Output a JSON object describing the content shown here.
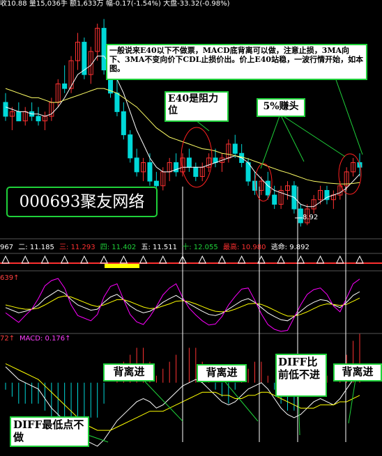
{
  "header": {
    "parts": [
      "收10.88",
      "量15,036手",
      "额1,633万",
      "幅-0.17(-1.54%)",
      "大盘-33.32(-0.98%)"
    ]
  },
  "stock_label": "000693聚友网络",
  "annotations": {
    "top_note": "一般说来E40以下不做票，MACD底背离可以做，注意止损，3MA向下、3MA不变向价下CDL止损价出。价上E40站稳，一波行情开始，如本图。",
    "resistance": "E40是阻力位",
    "profit": "5%赚头",
    "diverge_1": "背离进",
    "diverge_2": "背离进",
    "diff_low": "DIFF比前低不进",
    "diverge_3": "背离进",
    "diff_bottom": "DIFF最低点不做",
    "low_price": "8.92"
  },
  "ma_row": [
    {
      "label": "967",
      "color": "#ffffff"
    },
    {
      "label": "二: 11.185",
      "color": "#ffffff"
    },
    {
      "label": "三: 11.293",
      "color": "#ff3030"
    },
    {
      "label": "四: 11.402",
      "color": "#1fd23a"
    },
    {
      "label": "五: 11.511",
      "color": "#ffffff"
    },
    {
      "label": "十: 12.055",
      "color": "#1fd23a"
    },
    {
      "label": "最高: 10.980",
      "color": "#ff3030"
    },
    {
      "label": "逃命: 9.892",
      "color": "#ffffff"
    }
  ],
  "indicator_labels": {
    "kdj": "639↑",
    "macd_prefix": "72↑",
    "macd": "MACD: 0.176↑"
  },
  "colors": {
    "up": "#ff3232",
    "down": "#00d8d8",
    "ma_white": "#ffffff",
    "ma_yellow": "#ffff66",
    "note_border": "#1fd23a",
    "kdj_k": "#ffffff",
    "kdj_d": "#ffff00",
    "kdj_j": "#ff00ff"
  },
  "chart_data": {
    "type": "line",
    "price_candles_ohlc": [
      [
        11.6,
        11.8,
        11.2,
        11.3
      ],
      [
        11.3,
        11.5,
        11.0,
        11.4
      ],
      [
        11.4,
        11.6,
        11.2,
        11.2
      ],
      [
        11.2,
        11.5,
        11.1,
        11.4
      ],
      [
        11.4,
        11.6,
        11.2,
        11.3
      ],
      [
        11.3,
        11.5,
        11.1,
        11.2
      ],
      [
        11.2,
        11.4,
        11.0,
        11.3
      ],
      [
        11.3,
        11.7,
        11.2,
        11.6
      ],
      [
        11.6,
        12.1,
        11.5,
        12.0
      ],
      [
        12.0,
        12.4,
        11.8,
        11.9
      ],
      [
        11.9,
        12.6,
        11.8,
        12.5
      ],
      [
        12.5,
        13.1,
        12.3,
        12.9
      ],
      [
        12.9,
        13.0,
        12.1,
        12.2
      ],
      [
        12.2,
        12.8,
        12.0,
        12.7
      ],
      [
        12.7,
        13.3,
        12.5,
        13.2
      ],
      [
        13.2,
        13.4,
        12.2,
        12.3
      ],
      [
        12.3,
        12.6,
        11.7,
        11.8
      ],
      [
        11.8,
        12.1,
        11.3,
        11.4
      ],
      [
        11.4,
        11.6,
        10.8,
        10.9
      ],
      [
        10.9,
        11.0,
        10.3,
        10.4
      ],
      [
        10.4,
        10.6,
        10.0,
        10.1
      ],
      [
        10.1,
        10.4,
        9.9,
        10.3
      ],
      [
        10.3,
        10.5,
        9.8,
        9.9
      ],
      [
        9.9,
        10.1,
        9.6,
        9.8
      ],
      [
        9.8,
        10.2,
        9.7,
        10.1
      ],
      [
        10.1,
        10.4,
        9.9,
        10.3
      ],
      [
        10.3,
        10.5,
        10.0,
        10.1
      ],
      [
        10.1,
        10.5,
        10.0,
        10.4
      ],
      [
        10.4,
        10.6,
        10.1,
        10.2
      ],
      [
        10.2,
        10.3,
        9.9,
        10.0
      ],
      [
        10.0,
        10.3,
        9.9,
        10.2
      ],
      [
        10.2,
        10.5,
        10.1,
        10.4
      ],
      [
        10.4,
        10.6,
        10.2,
        10.3
      ],
      [
        10.3,
        10.5,
        10.1,
        10.4
      ],
      [
        10.4,
        10.8,
        10.3,
        10.7
      ],
      [
        10.7,
        10.9,
        10.4,
        10.5
      ],
      [
        10.5,
        10.7,
        10.2,
        10.3
      ],
      [
        10.3,
        10.4,
        9.8,
        9.9
      ],
      [
        9.9,
        10.1,
        9.6,
        9.7
      ],
      [
        9.7,
        10.0,
        9.6,
        9.9
      ],
      [
        9.9,
        10.1,
        9.5,
        9.6
      ],
      [
        9.6,
        9.8,
        9.3,
        9.4
      ],
      [
        9.4,
        9.8,
        9.3,
        9.7
      ],
      [
        9.7,
        9.9,
        9.5,
        9.8
      ],
      [
        9.8,
        9.9,
        9.2,
        9.3
      ],
      [
        9.3,
        9.4,
        8.92,
        9.0
      ],
      [
        9.0,
        9.4,
        8.95,
        9.3
      ],
      [
        9.3,
        9.6,
        9.2,
        9.5
      ],
      [
        9.5,
        9.8,
        9.4,
        9.7
      ],
      [
        9.7,
        9.8,
        9.4,
        9.5
      ],
      [
        9.5,
        9.7,
        9.3,
        9.6
      ],
      [
        9.6,
        9.9,
        9.5,
        9.8
      ],
      [
        9.8,
        10.2,
        9.7,
        10.1
      ],
      [
        10.1,
        10.4,
        10.0,
        10.3
      ],
      [
        10.3,
        10.5,
        10.0,
        10.2
      ]
    ],
    "price_ma_white": [
      11.5,
      11.45,
      11.4,
      11.4,
      11.35,
      11.35,
      11.3,
      11.35,
      11.5,
      11.7,
      11.95,
      12.2,
      12.3,
      12.4,
      12.6,
      12.6,
      12.4,
      12.1,
      11.8,
      11.4,
      11.0,
      10.7,
      10.4,
      10.2,
      10.1,
      10.1,
      10.15,
      10.2,
      10.2,
      10.2,
      10.2,
      10.25,
      10.3,
      10.35,
      10.4,
      10.45,
      10.4,
      10.3,
      10.1,
      9.95,
      9.8,
      9.7,
      9.65,
      9.6,
      9.55,
      9.4,
      9.35,
      9.35,
      9.45,
      9.55,
      9.6,
      9.65,
      9.75,
      9.9,
      10.05
    ],
    "price_ma_yellow": [
      11.9,
      11.85,
      11.8,
      11.75,
      11.7,
      11.7,
      11.65,
      11.6,
      11.6,
      11.65,
      11.7,
      11.75,
      11.8,
      11.85,
      11.9,
      11.9,
      11.85,
      11.8,
      11.7,
      11.6,
      11.5,
      11.35,
      11.2,
      11.05,
      10.95,
      10.85,
      10.8,
      10.75,
      10.7,
      10.65,
      10.6,
      10.58,
      10.55,
      10.5,
      10.48,
      10.45,
      10.42,
      10.38,
      10.33,
      10.28,
      10.22,
      10.17,
      10.12,
      10.08,
      10.03,
      9.98,
      9.93,
      9.9,
      9.88,
      9.86,
      9.85,
      9.84,
      9.84,
      9.85,
      9.87
    ],
    "kdj_k": [
      45,
      40,
      35,
      38,
      42,
      50,
      62,
      70,
      78,
      72,
      60,
      50,
      45,
      40,
      42,
      55,
      65,
      70,
      60,
      48,
      40,
      35,
      38,
      45,
      55,
      62,
      68,
      60,
      52,
      45,
      38,
      32,
      30,
      34,
      42,
      50,
      58,
      62,
      55,
      45,
      35,
      28,
      22,
      20,
      28,
      38,
      48,
      55,
      60,
      58,
      50,
      45,
      55,
      68,
      75
    ],
    "kdj_d": [
      50,
      47,
      44,
      42,
      42,
      44,
      50,
      57,
      64,
      67,
      65,
      60,
      55,
      50,
      47,
      50,
      55,
      60,
      60,
      56,
      51,
      46,
      43,
      44,
      48,
      52,
      57,
      58,
      56,
      52,
      47,
      42,
      38,
      37,
      38,
      42,
      47,
      52,
      53,
      51,
      46,
      40,
      34,
      29,
      29,
      32,
      37,
      43,
      49,
      52,
      51,
      49,
      51,
      57,
      63
    ],
    "kdj_j": [
      35,
      26,
      17,
      30,
      42,
      62,
      86,
      96,
      100,
      82,
      50,
      30,
      25,
      20,
      32,
      65,
      85,
      90,
      60,
      32,
      18,
      13,
      28,
      47,
      69,
      82,
      90,
      64,
      44,
      31,
      20,
      12,
      14,
      28,
      50,
      66,
      80,
      82,
      59,
      33,
      13,
      4,
      0,
      2,
      26,
      50,
      70,
      79,
      82,
      70,
      48,
      37,
      63,
      90,
      99
    ],
    "macd_diff": [
      0.05,
      0.03,
      0.01,
      0.0,
      -0.01,
      -0.02,
      -0.05,
      -0.08,
      -0.1,
      -0.12,
      -0.14,
      -0.16,
      -0.18,
      -0.19,
      -0.2,
      -0.18,
      -0.15,
      -0.12,
      -0.1,
      -0.08,
      -0.06,
      -0.05,
      -0.06,
      -0.08,
      -0.07,
      -0.05,
      -0.03,
      -0.01,
      0.0,
      0.01,
      0.0,
      -0.02,
      -0.04,
      -0.06,
      -0.07,
      -0.06,
      -0.04,
      -0.02,
      -0.01,
      0.0,
      -0.02,
      -0.05,
      -0.08,
      -0.1,
      -0.11,
      -0.1,
      -0.08,
      -0.06,
      -0.05,
      -0.06,
      -0.07,
      -0.05,
      -0.02,
      0.01,
      0.03
    ],
    "macd_dea": [
      0.06,
      0.05,
      0.04,
      0.03,
      0.02,
      0.01,
      -0.01,
      -0.03,
      -0.05,
      -0.07,
      -0.09,
      -0.11,
      -0.13,
      -0.14,
      -0.15,
      -0.15,
      -0.15,
      -0.14,
      -0.13,
      -0.12,
      -0.11,
      -0.1,
      -0.09,
      -0.09,
      -0.09,
      -0.08,
      -0.07,
      -0.06,
      -0.05,
      -0.04,
      -0.03,
      -0.03,
      -0.03,
      -0.04,
      -0.04,
      -0.05,
      -0.05,
      -0.04,
      -0.04,
      -0.03,
      -0.03,
      -0.04,
      -0.05,
      -0.06,
      -0.07,
      -0.08,
      -0.08,
      -0.08,
      -0.07,
      -0.07,
      -0.07,
      -0.06,
      -0.06,
      -0.05,
      -0.04
    ],
    "macd_hist": [
      -0.01,
      -0.02,
      -0.03,
      -0.03,
      -0.03,
      -0.03,
      -0.04,
      -0.05,
      -0.05,
      -0.05,
      -0.05,
      -0.05,
      -0.05,
      -0.05,
      -0.05,
      -0.03,
      0.0,
      0.02,
      0.03,
      0.04,
      0.05,
      0.05,
      0.03,
      0.01,
      0.02,
      0.03,
      0.04,
      0.05,
      0.05,
      0.05,
      0.03,
      0.01,
      -0.01,
      -0.02,
      -0.03,
      -0.01,
      0.01,
      0.02,
      0.03,
      0.03,
      0.01,
      -0.01,
      -0.03,
      -0.04,
      -0.04,
      -0.02,
      0.0,
      0.02,
      0.02,
      0.01,
      0.0,
      0.01,
      0.04,
      0.06,
      0.07
    ]
  }
}
